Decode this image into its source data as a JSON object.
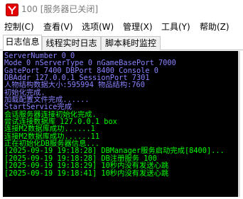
{
  "window": {
    "title": "100 [服务器已关闭]"
  },
  "menu": {
    "items": [
      {
        "label": "控制(C)"
      },
      {
        "label": "查看(V)"
      },
      {
        "label": "选项(W)"
      },
      {
        "label": "管理(X)"
      },
      {
        "label": "工具(Y)"
      },
      {
        "label": "帮助(Z)"
      }
    ]
  },
  "tabs": [
    {
      "label": "日志信息",
      "active": true
    },
    {
      "label": "线程实时日志",
      "active": false
    },
    {
      "label": "脚本耗时监控",
      "active": false
    }
  ],
  "colors": {
    "console_background": "#000000",
    "log_default": "#00ff00",
    "log_config": "#8a82ff",
    "app_icon_red": "#e40000"
  },
  "log": [
    {
      "text": "ServerNumber 0 0",
      "color": "#8a82ff"
    },
    {
      "text": "Mode 0 nServerType 0  nGameBasePort 7000",
      "color": "#8a82ff"
    },
    {
      "text": "GatePort 7400  DBPort 8400 Console 0",
      "color": "#8a82ff"
    },
    {
      "text": "DBAddr 127.0.0.1  SessionPort 7301",
      "color": "#8a82ff"
    },
    {
      "text": "人物结构数据大小:595994 物品结构:760",
      "color": "#8a82ff"
    },
    {
      "text": "初始化完成.",
      "color": "#8a82ff"
    },
    {
      "text": "加载配置文件完成......",
      "color": "#8a82ff"
    },
    {
      "text": "StartService完成",
      "color": "#8a82ff"
    },
    {
      "text": "会话服务器连接初始化完成.",
      "color": "#00ff00"
    },
    {
      "text": "尝试连接数据库 127.0.0.1 box",
      "color": "#00ff00"
    },
    {
      "text": "连接M2数据库成功......1",
      "color": "#00ff00"
    },
    {
      "text": "连接M2数据库成功......11",
      "color": "#00ff00"
    },
    {
      "text": "正在初始化DB服务器信息...",
      "color": "#00ff00"
    },
    {
      "text": "[2025-09-19 19:18:28] DBManager服务启动完成[8400]...",
      "color": "#00ff00"
    },
    {
      "text": "[2025-09-19 19:18:28] DB注册服务 100",
      "color": "#00ff00"
    },
    {
      "text": "[2025-09-19 19:18:29] 10秒内没有发送心跳",
      "color": "#00ff00"
    },
    {
      "text": "[2025-09-19 19:18:41] 10秒内没有发送心跳",
      "color": "#00ff00"
    }
  ]
}
